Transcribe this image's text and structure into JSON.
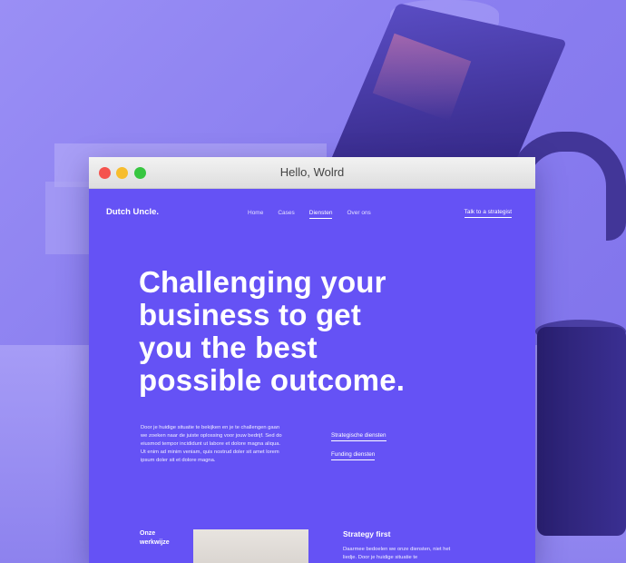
{
  "window": {
    "title": "Hello, Wolrd"
  },
  "site": {
    "logo": "Dutch Uncle.",
    "nav": [
      "Home",
      "Cases",
      "Diensten",
      "Over ons"
    ],
    "nav_active": "Diensten",
    "cta": "Talk to a strategist",
    "hero": [
      "Challenging your",
      "business to get",
      "you the best",
      "possible outcome."
    ],
    "intro": "Door je huidige situatie te bekijken en je te challengen gaan we zoeken naar de juiste oplossing voor jouw bedrijf. Sed do eiusmod tempor incididunt ut labore et dolore magna aliqua. Ut enim ad minim veniam, quis nostrud doler sit amet lorem ipsum doler sit et dolore magna.",
    "links": [
      "Strategische diensten",
      "Funding diensten"
    ],
    "werkwijze": [
      "Onze",
      "werkwijze"
    ],
    "strategy_title": "Strategy first",
    "strategy_body": "Daarmee bedoelen we onze diensten, niet het liedje. Door je huidige situatie te"
  },
  "colors": {
    "brand": "#6552f5",
    "background_tint": "#8f83f2"
  }
}
